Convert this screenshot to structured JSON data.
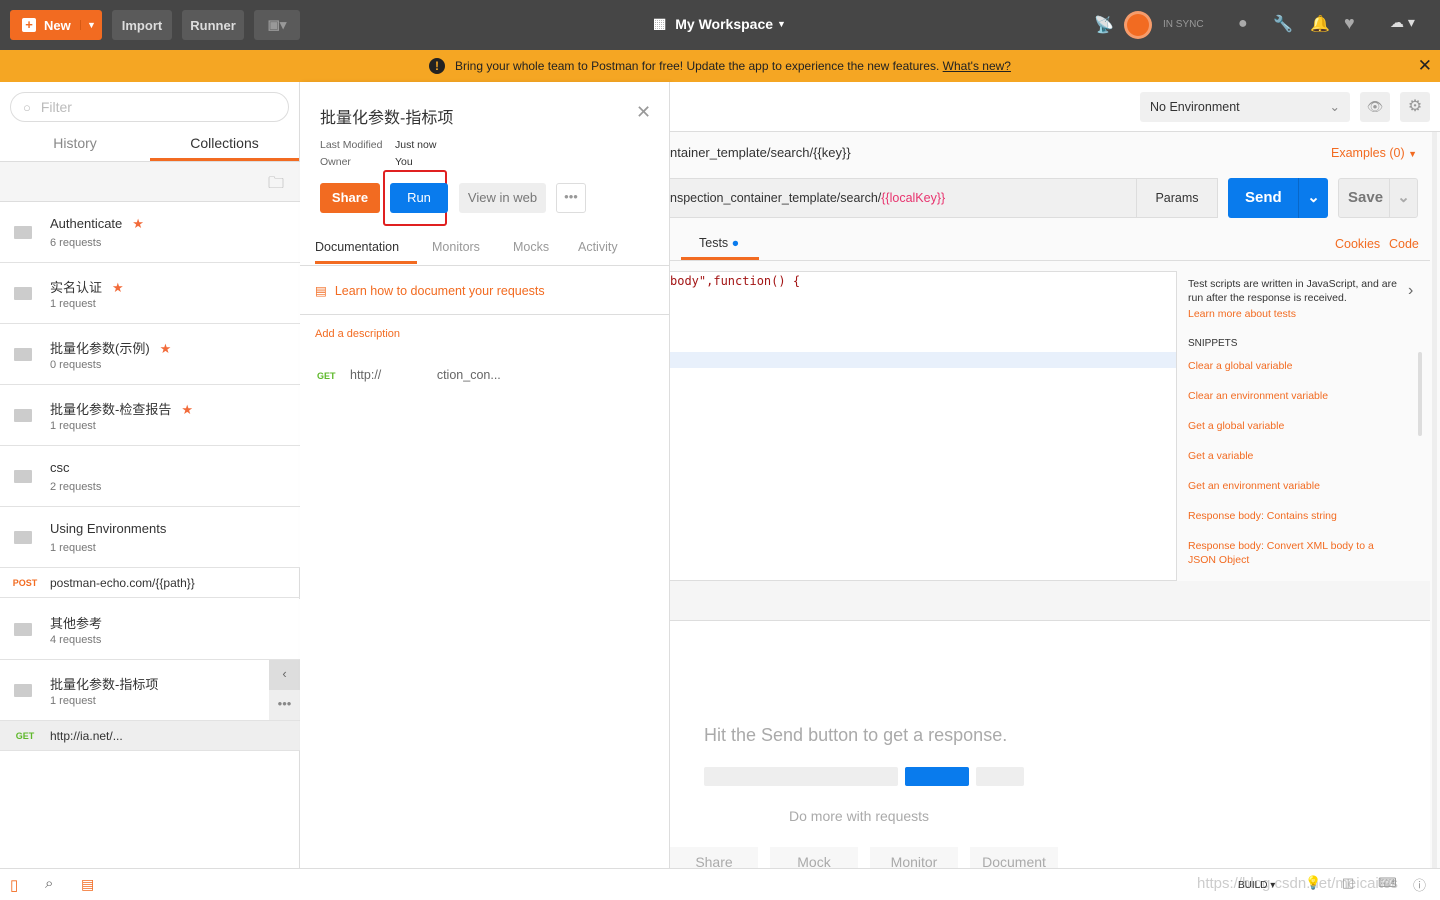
{
  "topbar": {
    "new_label": "New",
    "import_label": "Import",
    "runner_label": "Runner",
    "workspace_label": "My Workspace",
    "sync_label": "IN SYNC"
  },
  "banner": {
    "text": "Bring your whole team to Postman for free! Update the app to experience the new features.",
    "link": "What's new?"
  },
  "sidebar": {
    "filter_placeholder": "Filter",
    "tabs": [
      "History",
      "Collections"
    ],
    "collections": [
      {
        "name": "Authenticate",
        "count": "6 requests",
        "starred": true
      },
      {
        "name": "实名认证",
        "count": "1 request",
        "starred": true
      },
      {
        "name": "批量化参数(示例)",
        "count": "0 requests",
        "starred": true
      },
      {
        "name": "批量化参数-检查报告",
        "count": "1 request",
        "starred": true
      },
      {
        "name": "csc",
        "count": "2 requests",
        "starred": false
      },
      {
        "name": "Using Environments",
        "count": "1 request",
        "starred": false
      }
    ],
    "post_request": {
      "method": "POST",
      "url": "postman-echo.com/{{path}}"
    },
    "collections2": [
      {
        "name": "其他参考",
        "count": "4 requests"
      },
      {
        "name": "批量化参数-指标项",
        "count": "1 request"
      }
    ],
    "get_request": {
      "method": "GET",
      "url": "http://ia.net/..."
    }
  },
  "panel": {
    "title": "批量化参数-指标项",
    "last_modified_label": "Last Modified",
    "last_modified": "Just now",
    "owner_label": "Owner",
    "owner": "You",
    "share": "Share",
    "run": "Run",
    "view_web": "View in web",
    "tabs": [
      "Documentation",
      "Monitors",
      "Mocks",
      "Activity"
    ],
    "learn_link": "Learn how to document your requests",
    "add_desc": "Add a description",
    "request": {
      "method": "GET",
      "url": "http://                ction_con..."
    }
  },
  "main": {
    "environment": "No Environment",
    "request_name": "ntainer_template/search/{{key}}",
    "examples": "Examples (0)",
    "url_prefix": "nspection_container_template/search/",
    "url_var": "{{localKey}}",
    "params": "Params",
    "send": "Send",
    "save": "Save",
    "tab_tests": "Tests",
    "cookies": "Cookies",
    "code": "Code",
    "code_line": "body\",function() {",
    "tests_help": "Test scripts are written in JavaScript, and are run after the response is received.",
    "learn_tests": "Learn more about tests",
    "snippets_title": "SNIPPETS",
    "snippets": [
      "Clear a global variable",
      "Clear an environment variable",
      "Get a global variable",
      "Get a variable",
      "Get an environment variable",
      "Response body: Contains string",
      "Response body: Convert XML body to a JSON Object"
    ],
    "empty_title": "Hit the Send button to get a response.",
    "do_more": "Do more with requests",
    "actions": [
      "Share",
      "Mock",
      "Monitor",
      "Document"
    ]
  },
  "status": {
    "build": "BUILD ▾",
    "watermark": "https://blog.csdn.net/meicaitcs"
  },
  "colors": {
    "orange": "#f26b21",
    "blue": "#097bed",
    "topbar": "#464646",
    "banner": "#f5a623"
  }
}
